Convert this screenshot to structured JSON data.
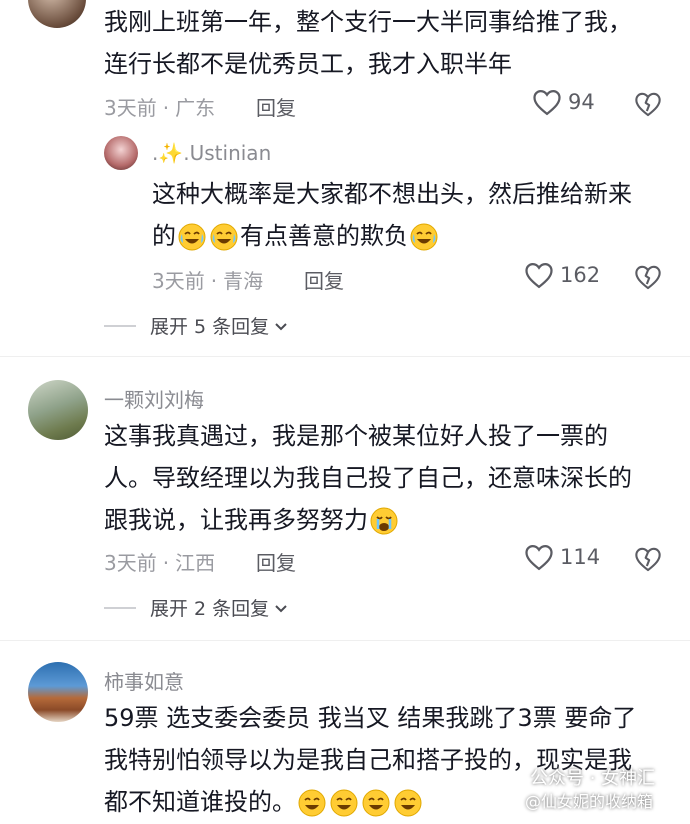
{
  "comments": [
    {
      "text_lines": [
        "我刚上班第一年，整个支行一大半同事给推了我，",
        "连行长都不是优秀员工，我才入职半年"
      ],
      "time": "3天前",
      "location": "广东",
      "reply": "回复",
      "likes": "94"
    },
    {
      "username": ".✨.Ustinian",
      "text_lines": [
        "这种大概率是大家都不想出头，然后推给新来",
        "的",
        "有点善意的欺负"
      ],
      "time": "3天前",
      "location": "青海",
      "reply": "回复",
      "likes": "162"
    },
    {
      "username": "一颗刘刘梅",
      "text_lines": [
        "这事我真遇过，我是那个被某位好人投了一票的",
        "人。导致经理以为我自己投了自己，还意味深长的",
        "跟我说，让我再多努努力"
      ],
      "time": "3天前",
      "location": "江西",
      "reply": "回复",
      "likes": "114"
    },
    {
      "username": "柿事如意",
      "text_lines": [
        "59票  选支委会委员  我当叉  结果我跳了3票  要命了",
        "我特别怕领导以为是我自己和搭子投的，现实是我",
        "都不知道谁投的。"
      ]
    }
  ],
  "expand1": "展开 5 条回复",
  "expand2": "展开 2 条回复",
  "watermark1": "公众号 · 女神汇",
  "watermark2": "@仙女妮的收纳箱",
  "icons": {
    "like": "heart-outline-icon",
    "dislike": "broken-heart-icon",
    "chevron": "chevron-down-icon",
    "emoji": "crying-laughing-emoji"
  }
}
